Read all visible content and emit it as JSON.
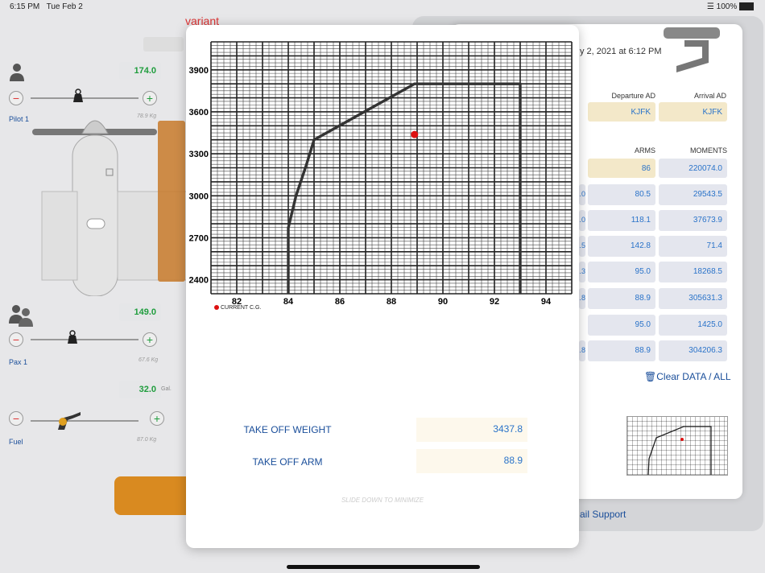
{
  "status_bar": {
    "time": "6:15 PM",
    "date": "Tue Feb 2",
    "battery": "100%"
  },
  "header": {
    "title_partial": "variant"
  },
  "left": {
    "pilot": {
      "value": "174.0",
      "weight": "78.9 Kg",
      "label": "Pilot 1"
    },
    "pax": {
      "value": "149.0",
      "weight": "67.6 Kg",
      "label": "Pax 1"
    },
    "fuel": {
      "value": "32.0",
      "unit": "Gal.",
      "weight": "87.0 Kg",
      "label": "Fuel"
    }
  },
  "right": {
    "date_text": "y 2, 2021 at 6:12 PM",
    "departure_label": "Departure AD",
    "arrival_label": "Arrival AD",
    "departure_value": "KJFK",
    "arrival_value": "KJFK",
    "arms_header": "ARMS",
    "moments_header": "MOMENTS",
    "rows": [
      {
        "arm": "86",
        "moment": "220074.0"
      },
      {
        "arm": "80.5",
        "moment": "29543.5"
      },
      {
        "arm": "118.1",
        "moment": "37673.9"
      },
      {
        "arm": "142.8",
        "moment": "71.4"
      },
      {
        "arm": "95.0",
        "moment": "18268.5"
      },
      {
        "arm": "88.9",
        "moment": "305631.3"
      },
      {
        "arm": "95.0",
        "moment": "1425.0"
      },
      {
        "arm": "88.9",
        "moment": "304206.3"
      }
    ],
    "left_edge_cells": [
      ".0",
      ".0",
      ".5",
      ".3",
      ".8",
      ".8"
    ],
    "clear_label": "Clear DATA / ALL",
    "support_label": "ail Support"
  },
  "modal": {
    "legend_label": "CURRENT C.G.",
    "takeoff_weight_label": "TAKE OFF WEIGHT",
    "takeoff_weight_value": "3437.8",
    "takeoff_arm_label": "TAKE OFF ARM",
    "takeoff_arm_value": "88.9",
    "hint": "SLIDE DOWN TO MINIMIZE"
  },
  "colors": {
    "accent_blue": "#1a4e9a",
    "value_blue": "#2a73c9",
    "green": "#1f9d3d",
    "red": "#dd1111",
    "envelope": "#333333"
  },
  "chart_data": {
    "type": "line",
    "xlabel": "",
    "ylabel": "",
    "x_ticks": [
      82,
      84,
      86,
      88,
      90,
      92,
      94
    ],
    "y_ticks": [
      2400,
      2700,
      3000,
      3300,
      3600,
      3900
    ],
    "xlim": [
      81,
      95
    ],
    "ylim": [
      2300,
      4100
    ],
    "series": [
      {
        "points": [
          [
            84,
            2300
          ],
          [
            84,
            2770
          ],
          [
            84.3,
            3000
          ],
          [
            84.7,
            3220
          ],
          [
            85,
            3400
          ],
          [
            88.9,
            3800
          ],
          [
            93,
            3800
          ],
          [
            93,
            2300
          ]
        ]
      }
    ],
    "current_cg": {
      "label": "CURRENT C.G.",
      "x": 88.9,
      "y": 3437.8
    },
    "grid": true
  }
}
